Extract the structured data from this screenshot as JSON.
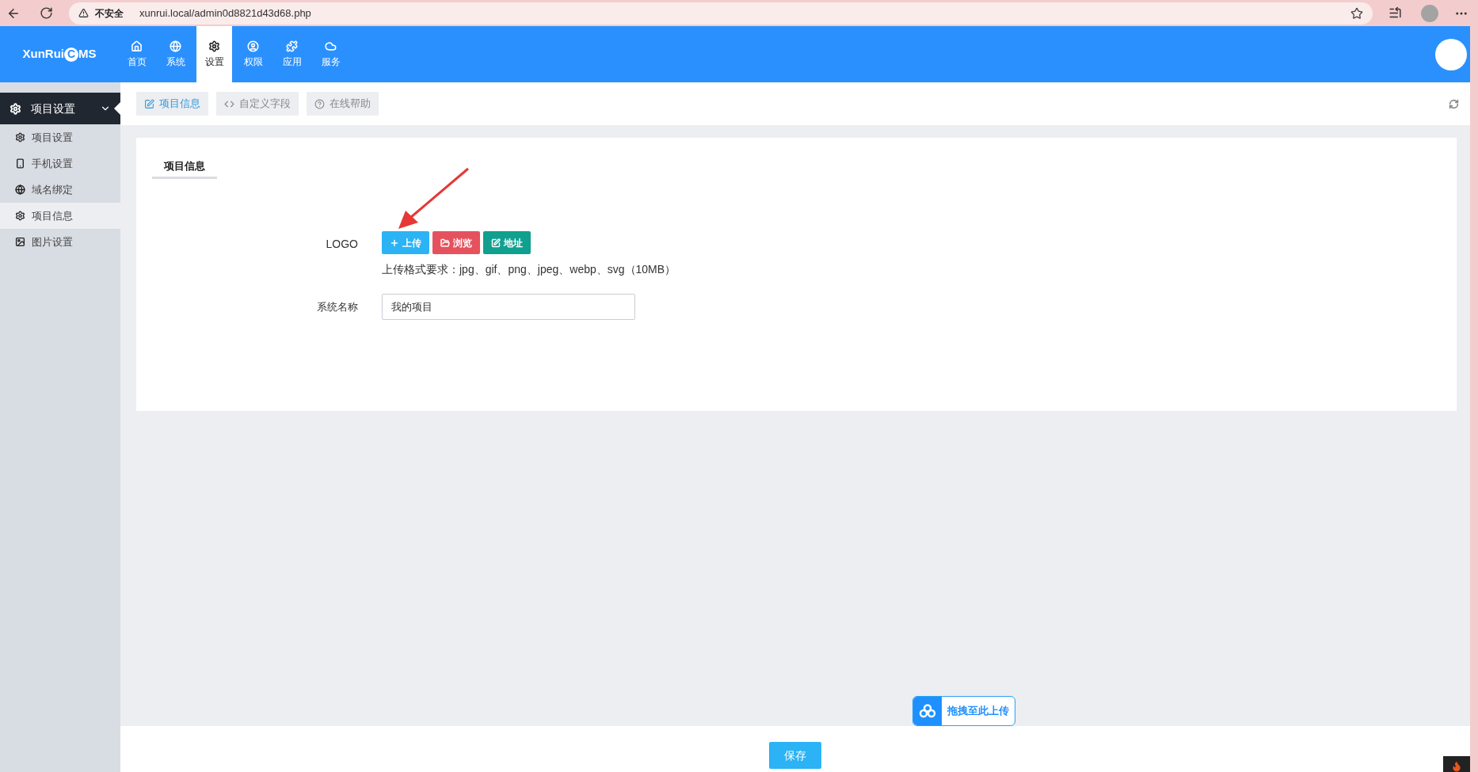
{
  "browser": {
    "security": "不安全",
    "url": "xunrui.local/admin0d8821d43d68.php"
  },
  "header": {
    "logo": {
      "before": "XunRui",
      "mark": "C",
      "after": "MS"
    },
    "nav": [
      {
        "label": "首页",
        "kind": "home",
        "selected": false
      },
      {
        "label": "系统",
        "kind": "globe",
        "selected": false
      },
      {
        "label": "设置",
        "kind": "cogs",
        "selected": true
      },
      {
        "label": "权限",
        "kind": "user",
        "selected": false
      },
      {
        "label": "应用",
        "kind": "puzzle",
        "selected": false
      },
      {
        "label": "服务",
        "kind": "cloud",
        "selected": false
      }
    ]
  },
  "sidebar": {
    "group": {
      "label": "项目设置",
      "expanded": true
    },
    "items": [
      {
        "label": "项目设置",
        "kind": "cog",
        "selected": false
      },
      {
        "label": "手机设置",
        "kind": "phone",
        "selected": false
      },
      {
        "label": "域名绑定",
        "kind": "globe",
        "selected": false
      },
      {
        "label": "项目信息",
        "kind": "cog",
        "selected": true
      },
      {
        "label": "图片设置",
        "kind": "image",
        "selected": false
      }
    ]
  },
  "toolbar": {
    "tabs": [
      {
        "label": "项目信息",
        "kind": "edit",
        "selected": true
      },
      {
        "label": "自定义字段",
        "kind": "code",
        "selected": false
      },
      {
        "label": "在线帮助",
        "kind": "help",
        "selected": false
      }
    ]
  },
  "form": {
    "section_tab": "项目信息",
    "logo_field": {
      "label": "LOGO",
      "buttons": [
        {
          "label": "上传",
          "kind": "upload"
        },
        {
          "label": "浏览",
          "kind": "browse"
        },
        {
          "label": "地址",
          "kind": "address"
        }
      ],
      "hint": "上传格式要求：jpg、gif、png、jpeg、webp、svg（10MB）"
    },
    "name_field": {
      "label": "系统名称",
      "value": "我的项目"
    }
  },
  "drop_upload": "拖拽至此上传",
  "save_button": "保存"
}
